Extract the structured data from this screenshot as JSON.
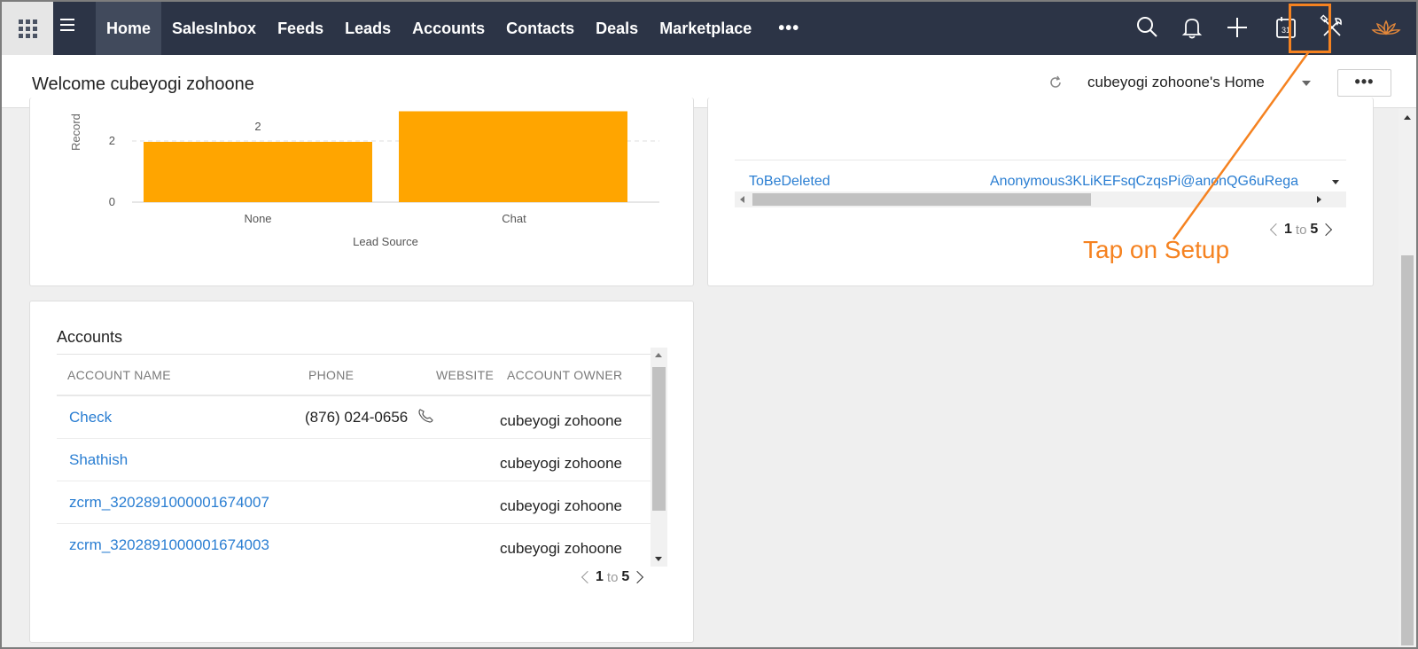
{
  "nav": {
    "items": [
      "Home",
      "SalesInbox",
      "Feeds",
      "Leads",
      "Accounts",
      "Contacts",
      "Deals",
      "Marketplace"
    ],
    "more": "•••",
    "calendar_day": "31",
    "icons": [
      "apps-grid-icon",
      "hamburger-icon",
      "search-icon",
      "bell-icon",
      "plus-icon",
      "calendar-icon",
      "setup-tools-icon",
      "lotus-logo-icon"
    ],
    "highlight_color": "#f58220"
  },
  "header": {
    "welcome": "Welcome cubeyogi zohoone",
    "home_select": "cubeyogi zohoone's Home",
    "more_label": "•••"
  },
  "chart_data": {
    "type": "bar",
    "categories": [
      "None",
      "Chat"
    ],
    "values": [
      2,
      3
    ],
    "data_labels": [
      "2",
      ""
    ],
    "xlabel": "Lead Source",
    "ylabel": "Record",
    "y_ticks": [
      0,
      2
    ],
    "bar_color": "#ffa500"
  },
  "right_table": {
    "row": {
      "name": "ToBeDeleted",
      "email": "Anonymous3KLiKEFsqCzqsPi@anonQG6uRega"
    },
    "pager": {
      "from": "1",
      "to_label": "to",
      "to": "5"
    }
  },
  "annotation": {
    "text": "Tap on Setup"
  },
  "accounts": {
    "title": "Accounts",
    "columns": [
      "ACCOUNT NAME",
      "PHONE",
      "WEBSITE",
      "ACCOUNT OWNER"
    ],
    "rows": [
      {
        "name": "Check",
        "phone": "(876) 024-0656",
        "owner": "cubeyogi zohoone"
      },
      {
        "name": "Shathish",
        "phone": "",
        "owner": "cubeyogi zohoone"
      },
      {
        "name": "zcrm_3202891000001674007",
        "phone": "",
        "owner": "cubeyogi zohoone"
      },
      {
        "name": "zcrm_3202891000001674003",
        "phone": "",
        "owner": "cubeyogi zohoone"
      }
    ],
    "pager": {
      "from": "1",
      "to_label": "to",
      "to": "5"
    }
  }
}
